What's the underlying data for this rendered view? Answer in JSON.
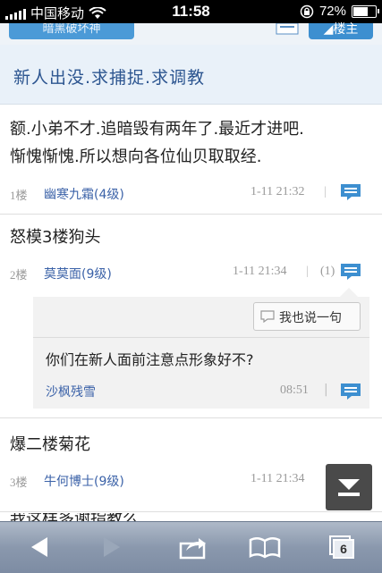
{
  "status_bar": {
    "carrier": "中国移动",
    "time": "11:58",
    "battery": "72%",
    "battery_level": 0.72
  },
  "top_toolbar": {
    "left_button_label": "暗黑破坏神",
    "right_button_label": "楼主"
  },
  "thread": {
    "title": "新人出没.求捕捉.求调教"
  },
  "posts": [
    {
      "body_line1": "额.小弟不才.追暗毁有两年了.最近才进吧.",
      "body_line2": "惭愧惭愧.所以想向各位仙贝取取经.",
      "floor": "1楼",
      "author": "幽寒九霜(4级)",
      "time": "1-11 21:32"
    },
    {
      "body": "怒模3楼狗头",
      "floor": "2楼",
      "author": "莫莫面(9级)",
      "time": "1-11 21:34",
      "reply_count": "(1)"
    },
    {
      "body": "爆二楼菊花",
      "floor": "3楼",
      "author": "牛何博士(9级)",
      "time": "1-11 21:34"
    },
    {
      "body_partial": "我这样多谢指教么"
    }
  ],
  "sub_reply": {
    "say_button_label": "我也说一句",
    "text": "你们在新人面前注意点形象好不?",
    "author": "沙枫残雪",
    "time": "08:51"
  },
  "bottom_toolbar": {
    "tabs_count": "6"
  }
}
